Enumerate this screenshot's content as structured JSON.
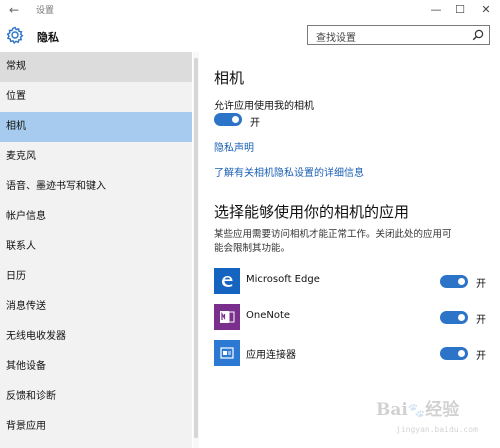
{
  "window": {
    "back_glyph": "←",
    "title": "设置",
    "minimize_glyph": "—",
    "maximize_glyph": "☐",
    "close_glyph": "✕"
  },
  "header": {
    "title": "隐私",
    "search_placeholder": "查找设置"
  },
  "sidebar": {
    "items": [
      {
        "label": "常规"
      },
      {
        "label": "位置"
      },
      {
        "label": "相机"
      },
      {
        "label": "麦克风"
      },
      {
        "label": "语音、墨迹书写和键入"
      },
      {
        "label": "帐户信息"
      },
      {
        "label": "联系人"
      },
      {
        "label": "日历"
      },
      {
        "label": "消息传送"
      },
      {
        "label": "无线电收发器"
      },
      {
        "label": "其他设备"
      },
      {
        "label": "反馈和诊断"
      },
      {
        "label": "背景应用"
      }
    ]
  },
  "main": {
    "title": "相机",
    "allow_label": "允许应用使用我的相机",
    "allow_state": "开",
    "privacy_link": "隐私声明",
    "learn_link": "了解有关相机隐私设置的详细信息",
    "section_title": "选择能够使用你的相机的应用",
    "section_desc": "某些应用需要访问相机才能正常工作。关闭此处的应用可能会限制其功能。",
    "apps": [
      {
        "name": "Microsoft Edge",
        "state": "开",
        "icon": "edge-icon",
        "color": "#1565c0"
      },
      {
        "name": "OneNote",
        "state": "开",
        "icon": "onenote-icon",
        "color": "#7b2f8c"
      },
      {
        "name": "应用连接器",
        "state": "开",
        "icon": "app-connector-icon",
        "color": "#2b79d2"
      }
    ]
  },
  "colors": {
    "accent": "#2c74c8",
    "selected_nav": "#a7cbee",
    "link": "#1a5fb4"
  }
}
